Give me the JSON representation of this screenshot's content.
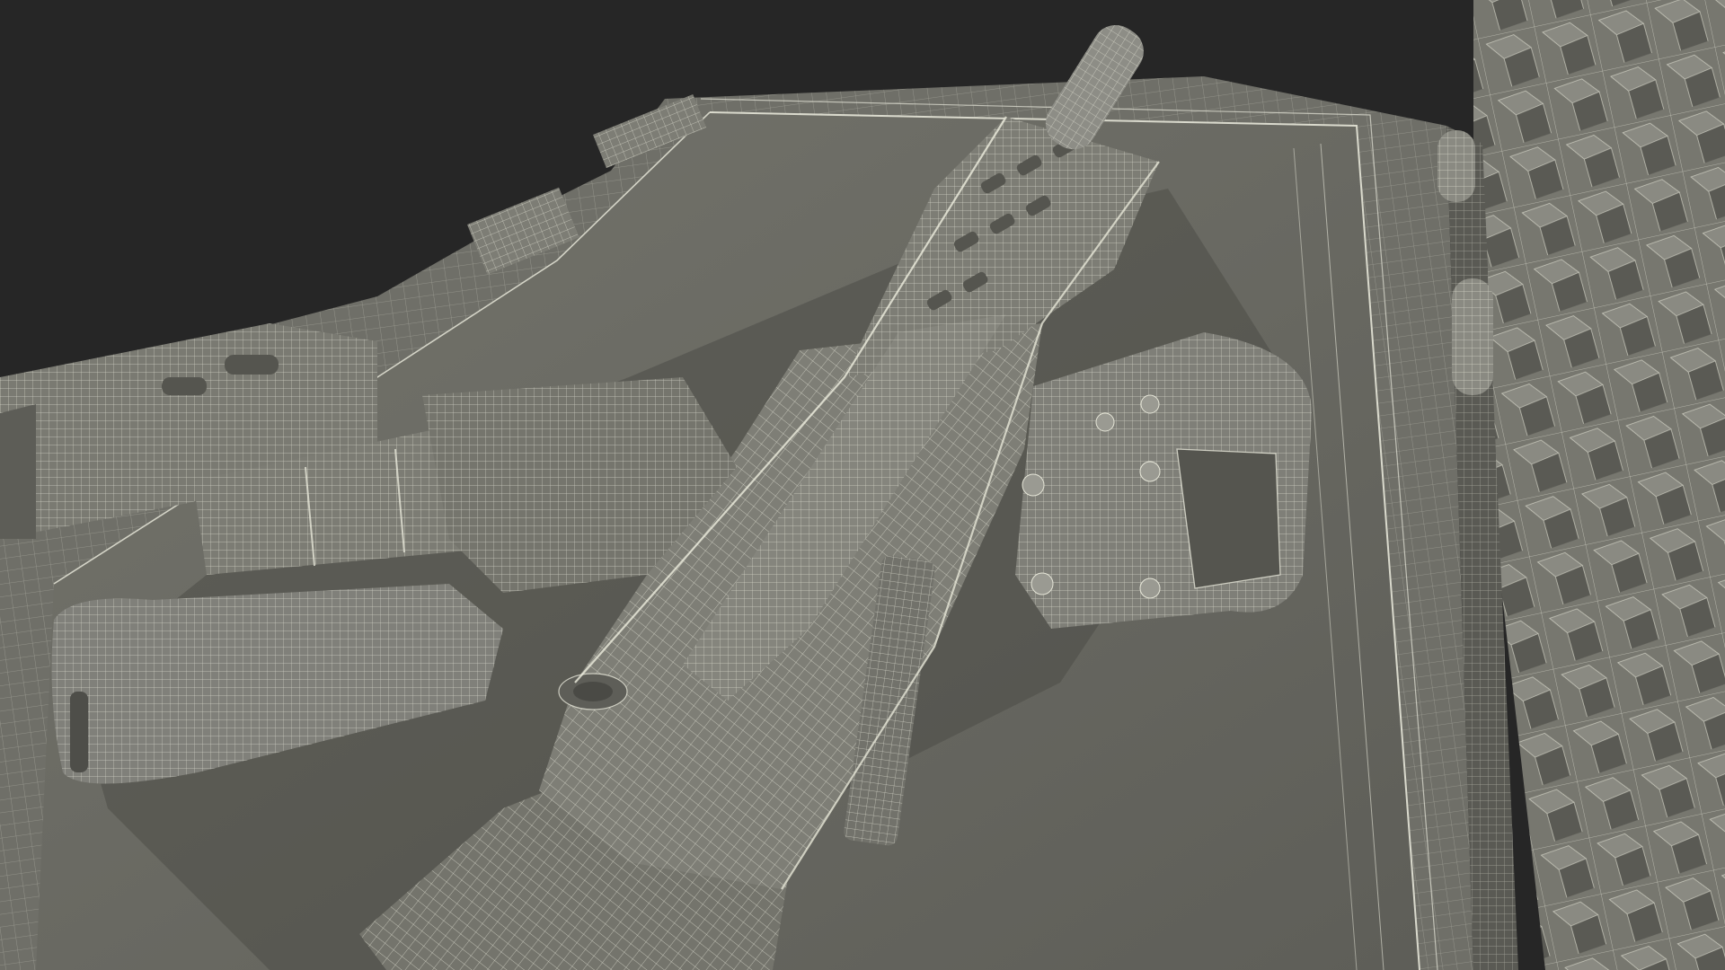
{
  "scene": {
    "subject": "wireframe-rifle-in-case",
    "render_style": "wireframe-over-clay",
    "colors": {
      "background": "#262626",
      "clay_dark": "#5c5c56",
      "clay": "#77776f",
      "clay_light": "#8c8c84",
      "floor": "#6a6a63",
      "wire": "#e6e6d8",
      "foam_shadow": "#3d3d39"
    }
  }
}
